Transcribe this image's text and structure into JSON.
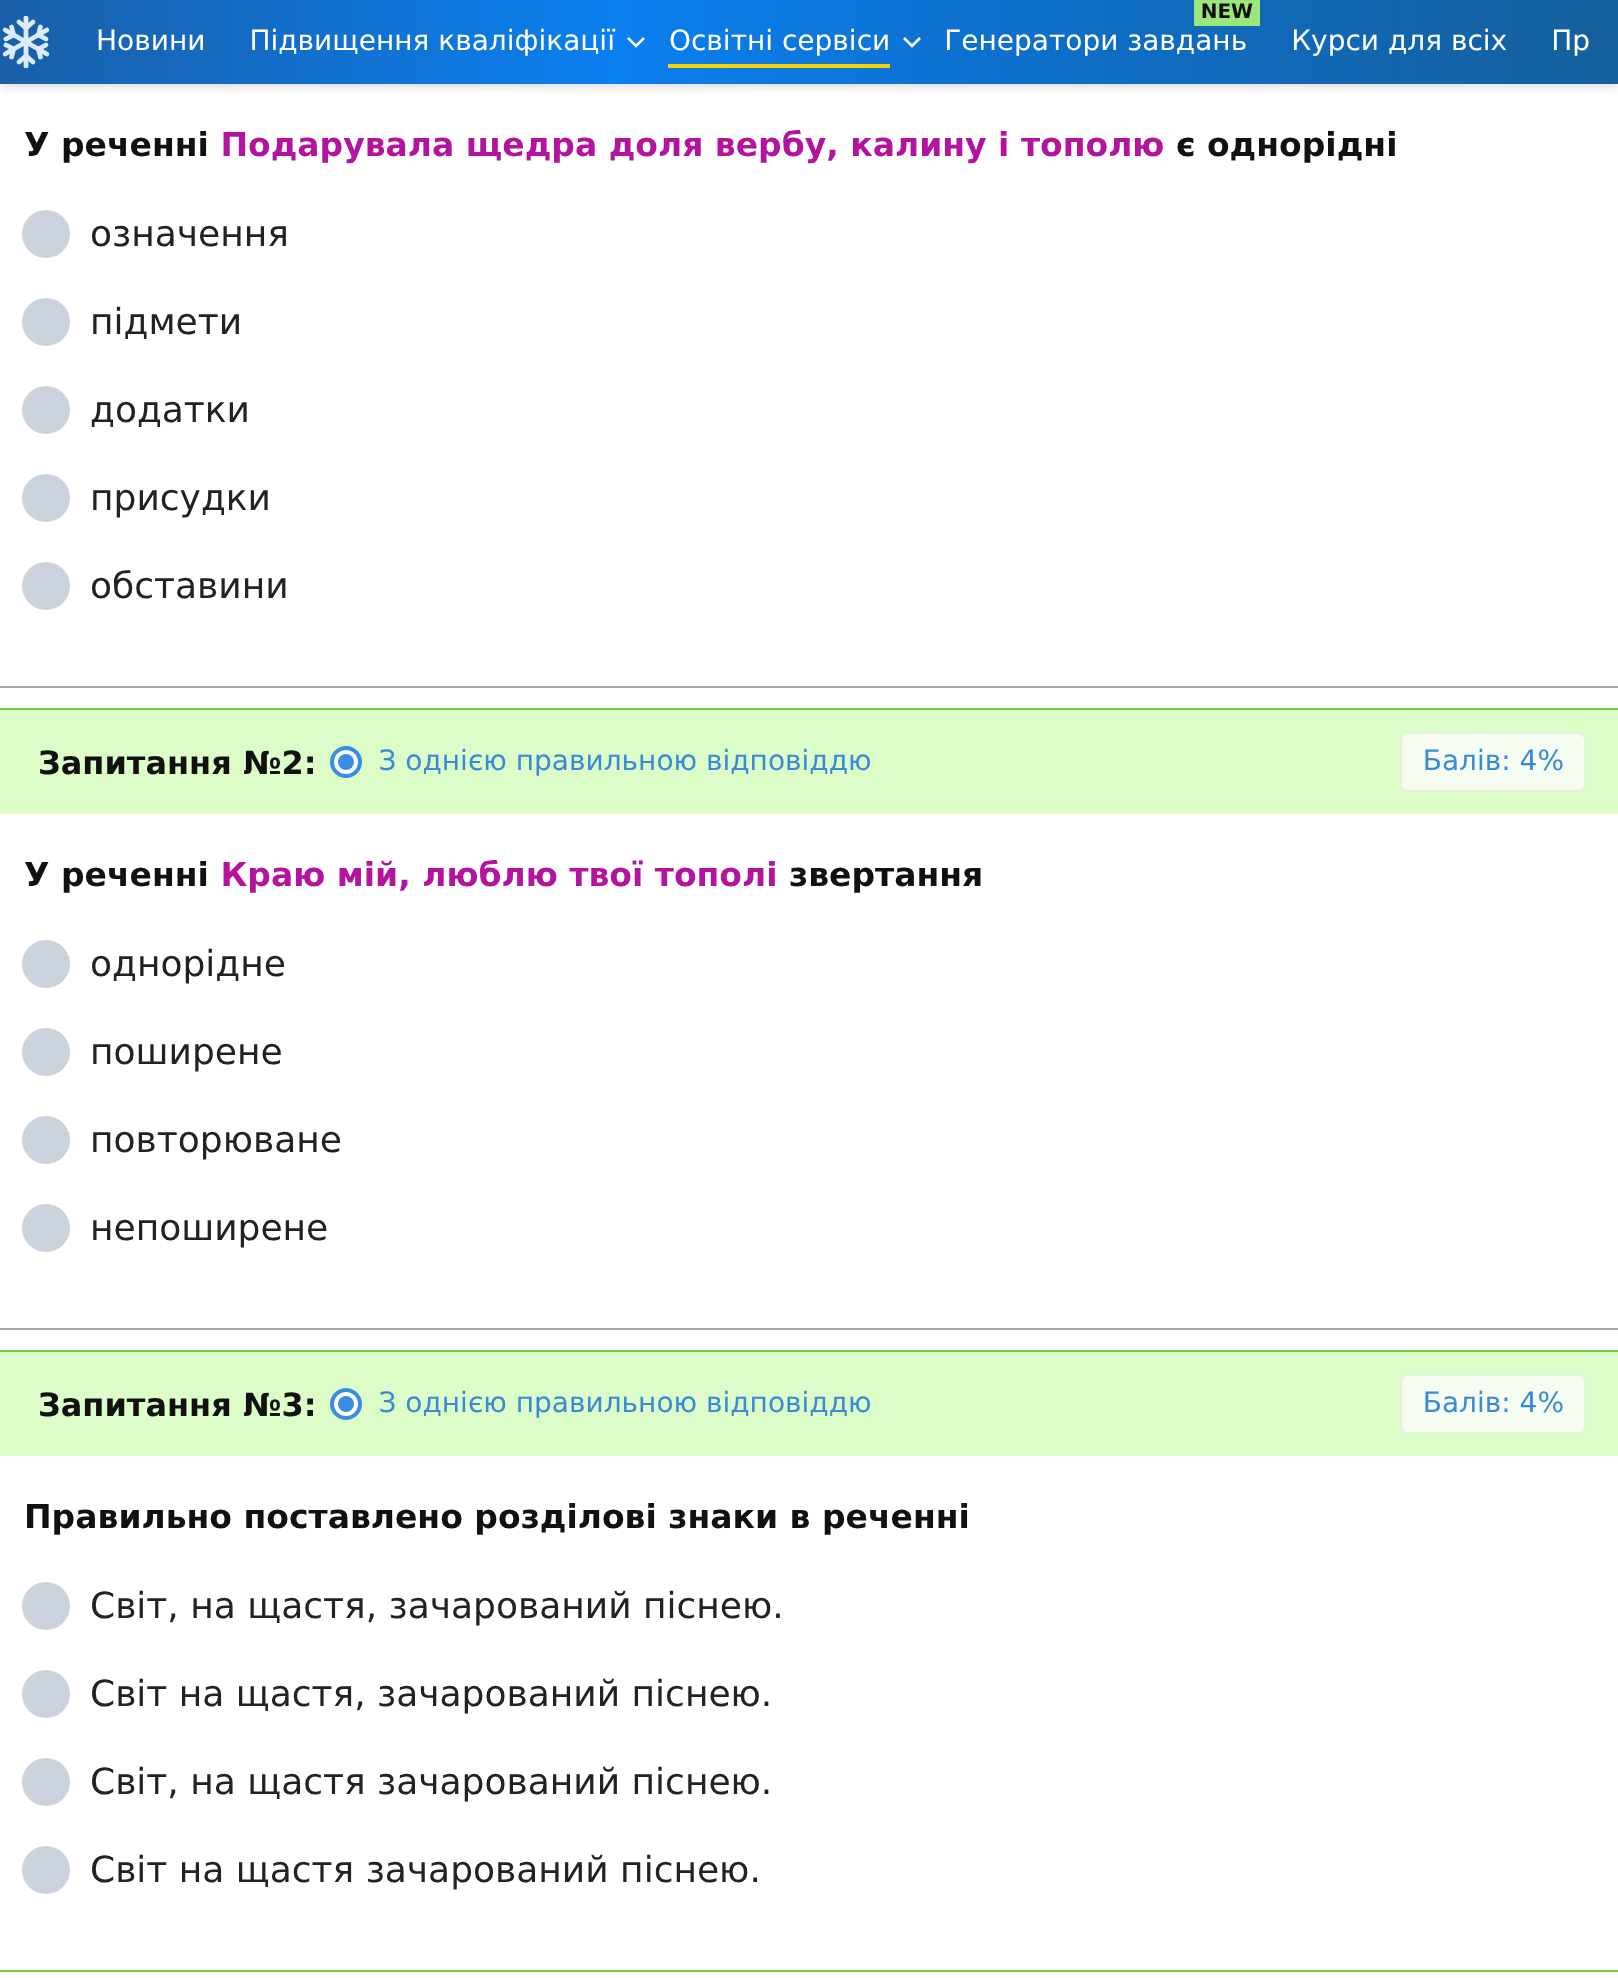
{
  "nav": {
    "items": [
      {
        "label": "Новини",
        "dropdown": false,
        "selected": false
      },
      {
        "label": "Підвищення кваліфікації",
        "dropdown": true,
        "selected": false
      },
      {
        "label": "Освітні сервіси",
        "dropdown": true,
        "selected": true
      },
      {
        "label": "Генератори завдань",
        "dropdown": false,
        "selected": false,
        "badge": "NEW"
      },
      {
        "label": "Курси для всіх",
        "dropdown": false,
        "selected": false
      },
      {
        "label": "Пр",
        "dropdown": false,
        "selected": false
      }
    ]
  },
  "questions": [
    {
      "prompt": [
        {
          "text": "У реченні ",
          "highlight": false
        },
        {
          "text": "Подарувала щедра доля вербу, калину і тополю",
          "highlight": true
        },
        {
          "text": " є однорідні",
          "highlight": false
        }
      ],
      "options": [
        {
          "label": "означення",
          "selected": false
        },
        {
          "label": "підмети",
          "selected": false
        },
        {
          "label": "додатки",
          "selected": false
        },
        {
          "label": "присудки",
          "selected": false
        },
        {
          "label": "обставини",
          "selected": false
        }
      ]
    },
    {
      "header": {
        "title": "Запитання №2:",
        "type_label": "З однією правильною відповіддю",
        "score": "Балів: 4%"
      },
      "prompt": [
        {
          "text": "У реченні ",
          "highlight": false
        },
        {
          "text": "Краю мій, люблю твої тополі",
          "highlight": true
        },
        {
          "text": " звертання",
          "highlight": false
        }
      ],
      "options": [
        {
          "label": "однорідне",
          "selected": false
        },
        {
          "label": "поширене",
          "selected": false
        },
        {
          "label": "повторюване",
          "selected": false
        },
        {
          "label": "непоширене",
          "selected": false
        }
      ]
    },
    {
      "header": {
        "title": "Запитання №3:",
        "type_label": "З однією правильною відповіддю",
        "score": "Балів: 4%"
      },
      "prompt": [
        {
          "text": "Правильно поставлено розділові знаки в реченні",
          "highlight": false
        }
      ],
      "options": [
        {
          "label": "Світ, на щастя, зачарований піснею.",
          "selected": false
        },
        {
          "label": "Світ на щастя, зачарований піснею.",
          "selected": false
        },
        {
          "label": "Світ, на щастя зачарований піснею.",
          "selected": false
        },
        {
          "label": "Світ на щастя зачарований піснею.",
          "selected": false
        }
      ]
    }
  ]
}
